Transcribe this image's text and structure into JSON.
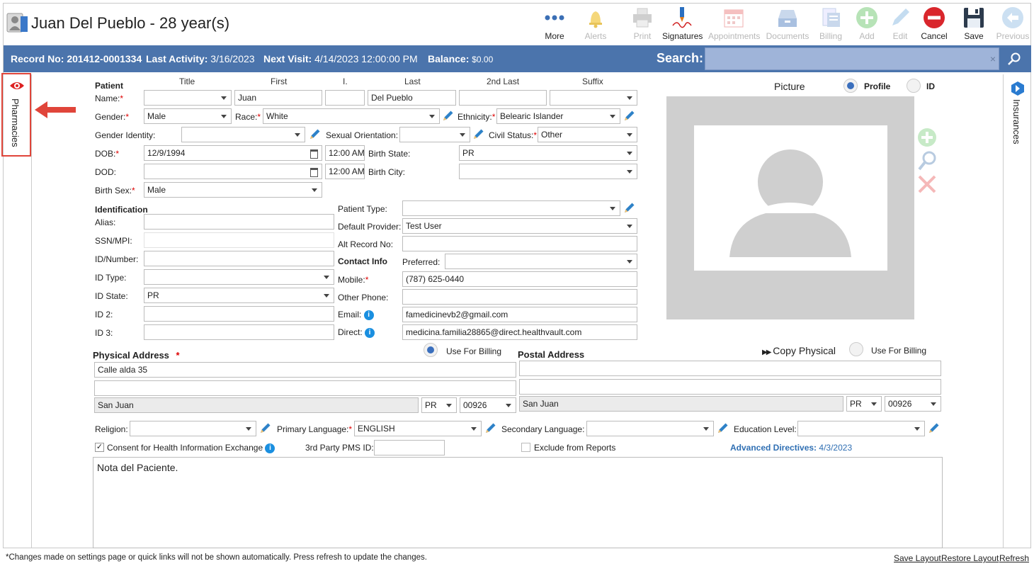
{
  "header": {
    "title": "Juan Del Pueblo - 28 year(s)",
    "toolbar": {
      "more": "More",
      "alerts": "Alerts",
      "print": "Print",
      "signatures": "Signatures",
      "appointments": "Appointments",
      "documents": "Documents",
      "billing": "Billing",
      "add": "Add",
      "edit": "Edit",
      "cancel": "Cancel",
      "save": "Save",
      "previous": "Previous"
    }
  },
  "infobar": {
    "record_label": "Record No:",
    "record_value": "201412-0001334",
    "activity_label": "Last Activity:",
    "activity_value": "3/16/2023",
    "visit_label": "Next Visit:",
    "visit_value": "4/14/2023 12:00:00 PM",
    "balance_label": "Balance:",
    "balance_value": "$0.00",
    "search_label": "Search:",
    "search_clear": "×"
  },
  "side": {
    "pharmacies": "Pharmacies",
    "insurances": "Insurances"
  },
  "patient": {
    "section": "Patient",
    "col_title": "Title",
    "col_first": "First",
    "col_i": "I.",
    "col_last": "Last",
    "col_2ndlast": "2nd Last",
    "col_suffix": "Suffix",
    "name_label": "Name:",
    "first": "Juan",
    "last": "Del Pueblo",
    "gender_label": "Gender:",
    "gender": "Male",
    "race_label": "Race:",
    "race": "White",
    "ethnicity_label": "Ethnicity:",
    "ethnicity": "Belearic Islander",
    "gender_identity_label": "Gender Identity:",
    "sexual_orientation_label": "Sexual Orientation:",
    "civil_status_label": "Civil Status:",
    "civil_status": "Other",
    "dob_label": "DOB:",
    "dob": "12/9/1994",
    "dob_time": "12:00 AM",
    "birth_state_label": "Birth State:",
    "birth_state": "PR",
    "dod_label": "DOD:",
    "dod_time": "12:00 AM",
    "birth_city_label": "Birth City:",
    "birth_sex_label": "Birth Sex:",
    "birth_sex": "Male"
  },
  "identification": {
    "section": "Identification",
    "alias_label": "Alias:",
    "ssn_label": "SSN/MPI:",
    "idnum_label": "ID/Number:",
    "idtype_label": "ID Type:",
    "idstate_label": "ID State:",
    "idstate": "PR",
    "id2_label": "ID 2:",
    "id3_label": "ID 3:"
  },
  "other": {
    "patient_type_label": "Patient Type:",
    "default_provider_label": "Default Provider:",
    "default_provider": "Test User",
    "alt_record_label": "Alt Record No:"
  },
  "contact": {
    "section": "Contact Info",
    "preferred_label": "Preferred:",
    "mobile_label": "Mobile:",
    "mobile": "(787) 625-0440",
    "other_phone_label": "Other Phone:",
    "email_label": "Email:",
    "email": "famedicinevb2@gmail.com",
    "direct_label": "Direct:",
    "direct": "medicina.familia28865@direct.healthvault.com"
  },
  "picture": {
    "label": "Picture",
    "profile": "Profile",
    "id": "ID"
  },
  "physical": {
    "section": "Physical Address",
    "use_billing": "Use For Billing",
    "line1": "Calle alda 35",
    "city": "San Juan",
    "state": "PR",
    "zip": "00926"
  },
  "postal": {
    "section": "Postal Address",
    "copy": "Copy Physical",
    "use_billing": "Use For Billing",
    "city": "San Juan",
    "state": "PR",
    "zip": "00926"
  },
  "misc": {
    "religion_label": "Religion:",
    "primary_lang_label": "Primary Language:",
    "primary_lang": "ENGLISH",
    "secondary_lang_label": "Secondary Language:",
    "education_label": "Education Level:",
    "consent": "Consent for Health Information Exchange",
    "third_party_label": "3rd Party PMS ID:",
    "exclude": "Exclude from Reports",
    "adv_label": "Advanced Directives:",
    "adv_value": "4/3/2023",
    "notes": "Nota del Paciente."
  },
  "footer": {
    "note": "*Changes made on settings page or quick links will not be shown automatically. Press refresh to update the changes.",
    "save_layout": "Save Layout",
    "restore_layout": "Restore Layout",
    "refresh": "Refresh"
  },
  "colors": {
    "bar": "#4b74ac",
    "accent": "#3a6fbd",
    "required": "#dd0000"
  }
}
